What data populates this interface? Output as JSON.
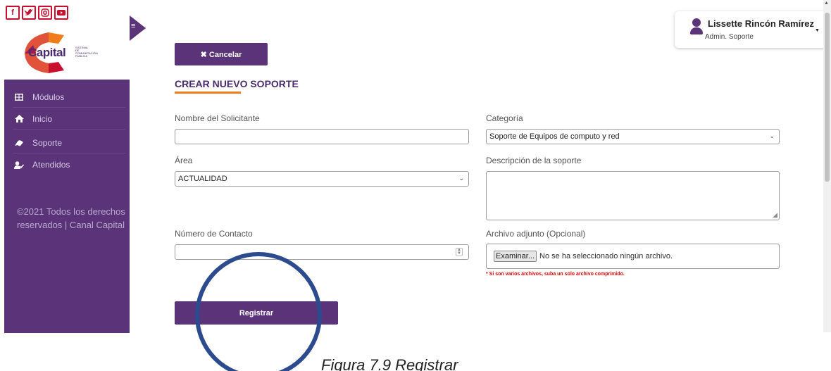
{
  "social": {
    "facebook_glyph": "f",
    "twitter_glyph": "t",
    "instagram_glyph": "◎",
    "youtube_glyph": "▶"
  },
  "brand": {
    "name": "Capital",
    "tagline": "SISTEMA DE COMUNICACIÓN PÚBLICA",
    "colors": {
      "purple": "#5a3379",
      "orange": "#f07c1b",
      "red": "#c8102e"
    }
  },
  "sidebar": {
    "items": [
      {
        "label": "Módulos",
        "icon": "grid-icon"
      },
      {
        "label": "Inicio",
        "icon": "home-icon"
      },
      {
        "label": "Soporte",
        "icon": "support-icon"
      },
      {
        "label": "Atendidos",
        "icon": "user-check-icon"
      }
    ],
    "footer": "©2021 Todos los derechos reservados | Canal Capital"
  },
  "user": {
    "name": "Lissette Rincón Ramírez",
    "role": "Admin. Soporte"
  },
  "form": {
    "cancel_label": "✖ Cancelar",
    "title": "CREAR NUEVO SOPORTE",
    "solicitante_label": "Nombre del Solicitante",
    "solicitante_value": "",
    "categoria_label": "Categoría",
    "categoria_value": "Soporte de Equipos de computo y red",
    "area_label": "Área",
    "area_value": "ACTUALIDAD",
    "descripcion_label": "Descripción de la soporte",
    "descripcion_value": "",
    "contacto_label": "Número de Contacto",
    "contacto_value": "",
    "archivo_label": "Archivo adjunto (Opcional)",
    "archivo_button": "Examinar...",
    "archivo_status": "No se ha seleccionado ningún archivo.",
    "archivo_warning": "* Si son varios archivos, suba un solo archivo comprimido.",
    "register_label": "Registrar"
  },
  "caption": "Figura 7.9 Registrar"
}
